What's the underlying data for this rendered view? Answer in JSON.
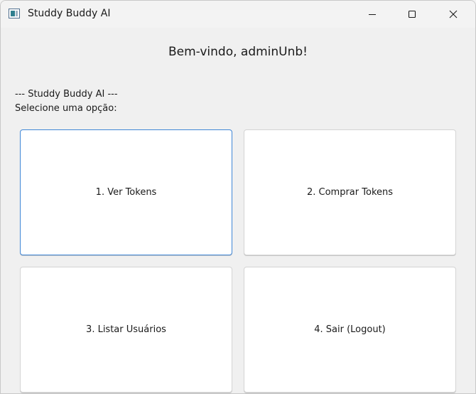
{
  "window": {
    "title": "Studdy Buddy AI"
  },
  "main": {
    "welcome": "Bem-vindo, adminUnb!",
    "header_line1": "--- Studdy Buddy AI ---",
    "header_line2": "Selecione uma opção:"
  },
  "menu": {
    "options": [
      {
        "label": "1. Ver Tokens"
      },
      {
        "label": "2. Comprar Tokens"
      },
      {
        "label": "3. Listar Usuários"
      },
      {
        "label": "4. Sair (Logout)"
      }
    ]
  }
}
